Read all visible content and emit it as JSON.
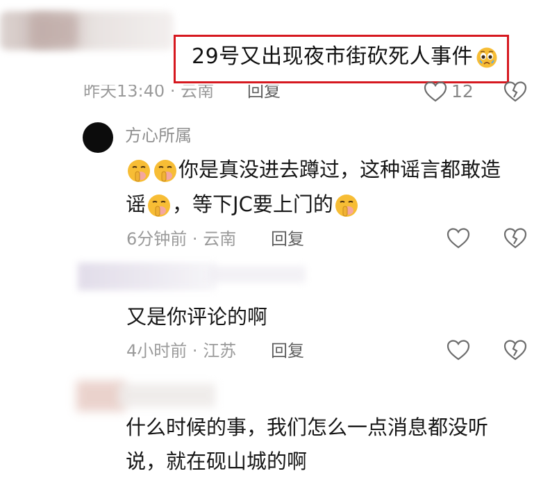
{
  "highlight": {
    "text": "29号又出现夜市街砍死人事件",
    "emoji": "pleading-face-emoji",
    "border_color": "#d6181f"
  },
  "comment_top": {
    "meta_time": "昨天13:40",
    "meta_sep": "·",
    "meta_location": "云南",
    "reply_label": "回复",
    "like_count": "12"
  },
  "comment_1": {
    "username": "方心所属",
    "line1": "你是真没进去蹲过，这种谣言都敢造",
    "line2_start": "谣",
    "line2_mid": "，等下JC要上门的",
    "emoji": "shushing-face-emoji",
    "meta_time": "6分钟前",
    "meta_sep": "·",
    "meta_location": "云南",
    "reply_label": "回复"
  },
  "comment_2": {
    "text": "又是你评论的啊",
    "meta_time": "4小时前",
    "meta_sep": "·",
    "meta_location": "江苏",
    "reply_label": "回复"
  },
  "comment_3": {
    "line1": "什么时候的事，我们怎么一点消息都没听",
    "line2": "说，就在砚山城的啊"
  },
  "icons": {
    "like": "heart-outline-icon",
    "dislike": "broken-heart-icon"
  },
  "colors": {
    "meta": "#9a9a9a",
    "reply": "#5e5e5e",
    "text": "#161616",
    "emoji": "#f7bd35"
  }
}
